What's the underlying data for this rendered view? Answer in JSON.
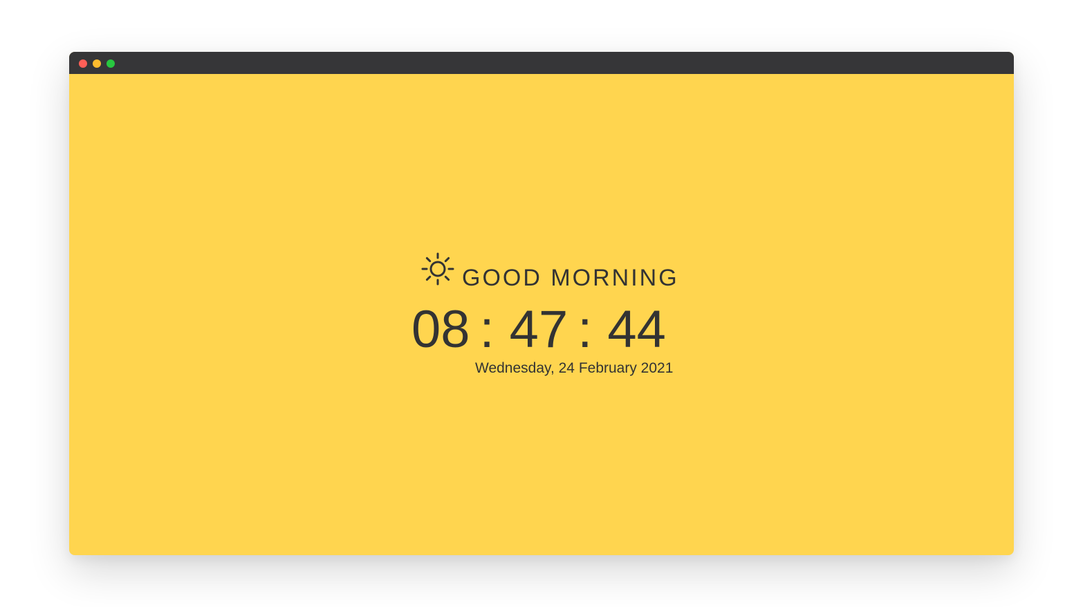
{
  "window": {
    "controls": {
      "close_color": "#FF5F57",
      "minimize_color": "#FEBC2E",
      "zoom_color": "#28C840"
    },
    "titlebar_color": "#363638",
    "background_color": "#FFD54F"
  },
  "greeting": {
    "icon": "sun-icon",
    "text": "GOOD MORNING"
  },
  "clock": {
    "hours": "08",
    "minutes": "47",
    "seconds": "44",
    "separator": ":"
  },
  "date": "Wednesday, 24 February 2021",
  "text_color": "#333333"
}
